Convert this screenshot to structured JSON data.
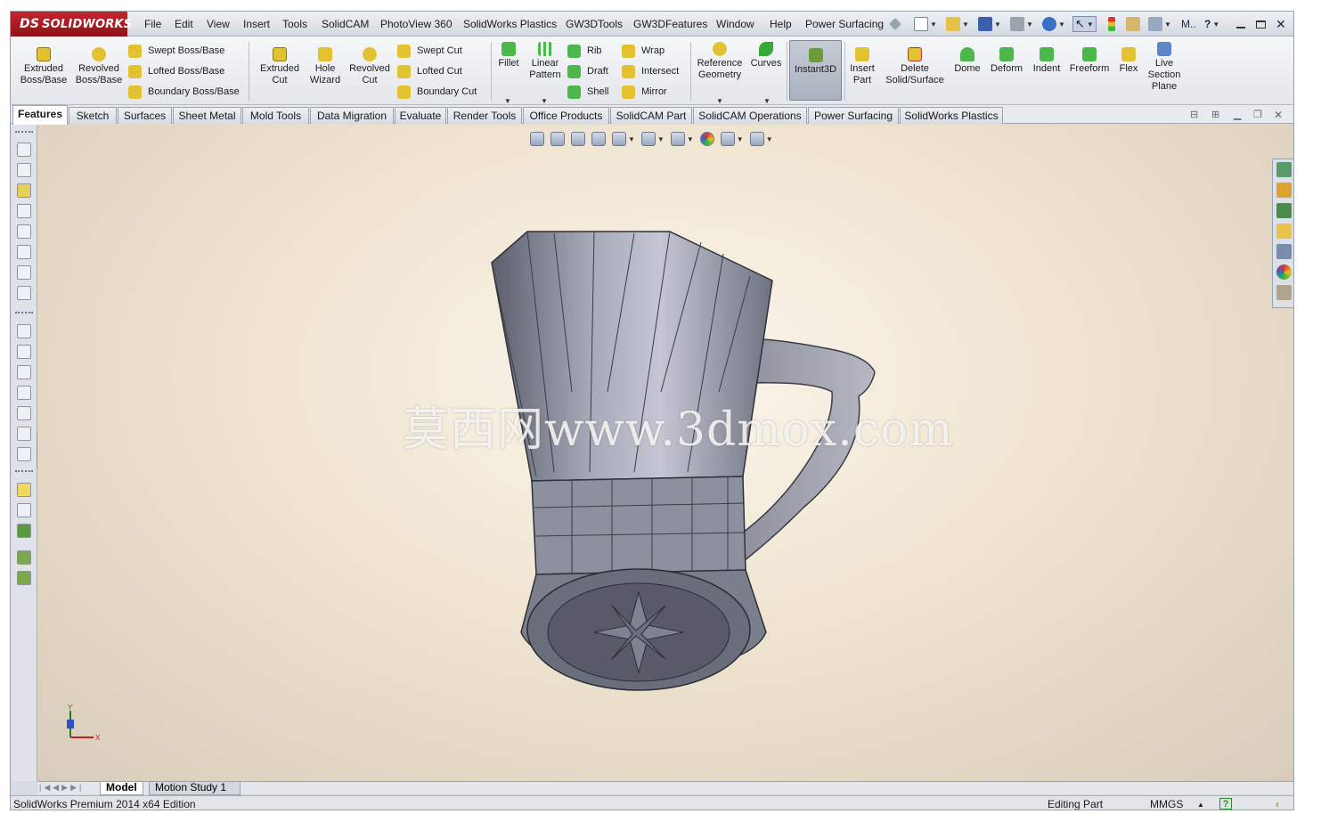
{
  "app": {
    "logo_ds": "DS",
    "logo_text": "SOLIDWORKS"
  },
  "menu": [
    "File",
    "Edit",
    "View",
    "Insert",
    "Tools",
    "SolidCAM",
    "PhotoView 360",
    "SolidWorks Plastics",
    "GW3DTools",
    "GW3DFeatures",
    "Window",
    "Help",
    "Power Surfacing"
  ],
  "quick_access": {
    "more_label": "M.."
  },
  "commands": {
    "extruded_boss": "Extruded Boss/Base",
    "revolved_boss": "Revolved Boss/Base",
    "swept_boss": "Swept Boss/Base",
    "lofted_boss": "Lofted Boss/Base",
    "boundary_boss": "Boundary Boss/Base",
    "extruded_cut": "Extruded Cut",
    "hole_wizard": "Hole Wizard",
    "revolved_cut": "Revolved Cut",
    "swept_cut": "Swept Cut",
    "lofted_cut": "Lofted Cut",
    "boundary_cut": "Boundary Cut",
    "fillet": "Fillet",
    "linear_pattern": "Linear Pattern",
    "rib": "Rib",
    "draft": "Draft",
    "shell": "Shell",
    "wrap": "Wrap",
    "intersect": "Intersect",
    "mirror": "Mirror",
    "reference_geometry": "Reference Geometry",
    "curves": "Curves",
    "instant3d": "Instant3D",
    "insert_part": "Insert Part",
    "delete_solid": "Delete Solid/Surface",
    "dome": "Dome",
    "deform": "Deform",
    "indent": "Indent",
    "freeform": "Freeform",
    "flex": "Flex",
    "live_section_plane": "Live Section Plane"
  },
  "tabs": [
    "Features",
    "Sketch",
    "Surfaces",
    "Sheet Metal",
    "Mold Tools",
    "Data Migration",
    "Evaluate",
    "Render Tools",
    "Office Products",
    "SolidCAM Part",
    "SolidCAM Operations",
    "Power Surfacing",
    "SolidWorks Plastics"
  ],
  "viewport": {
    "watermark": "莫西网www.3dmox.com",
    "triad_x": "X",
    "triad_y": "Y"
  },
  "bottom_tabs": [
    "Model",
    "Motion Study 1"
  ],
  "status": {
    "edition": "SolidWorks Premium 2014 x64 Edition",
    "mode": "Editing Part",
    "units": "MMGS",
    "units_caret": "▲",
    "help": "?",
    "arrow": "‹"
  },
  "colors": {
    "brand_red": "#b01c24",
    "icon_yellow": "#e8c020",
    "icon_green": "#38a838",
    "model_gray": "#8c8f9c"
  }
}
